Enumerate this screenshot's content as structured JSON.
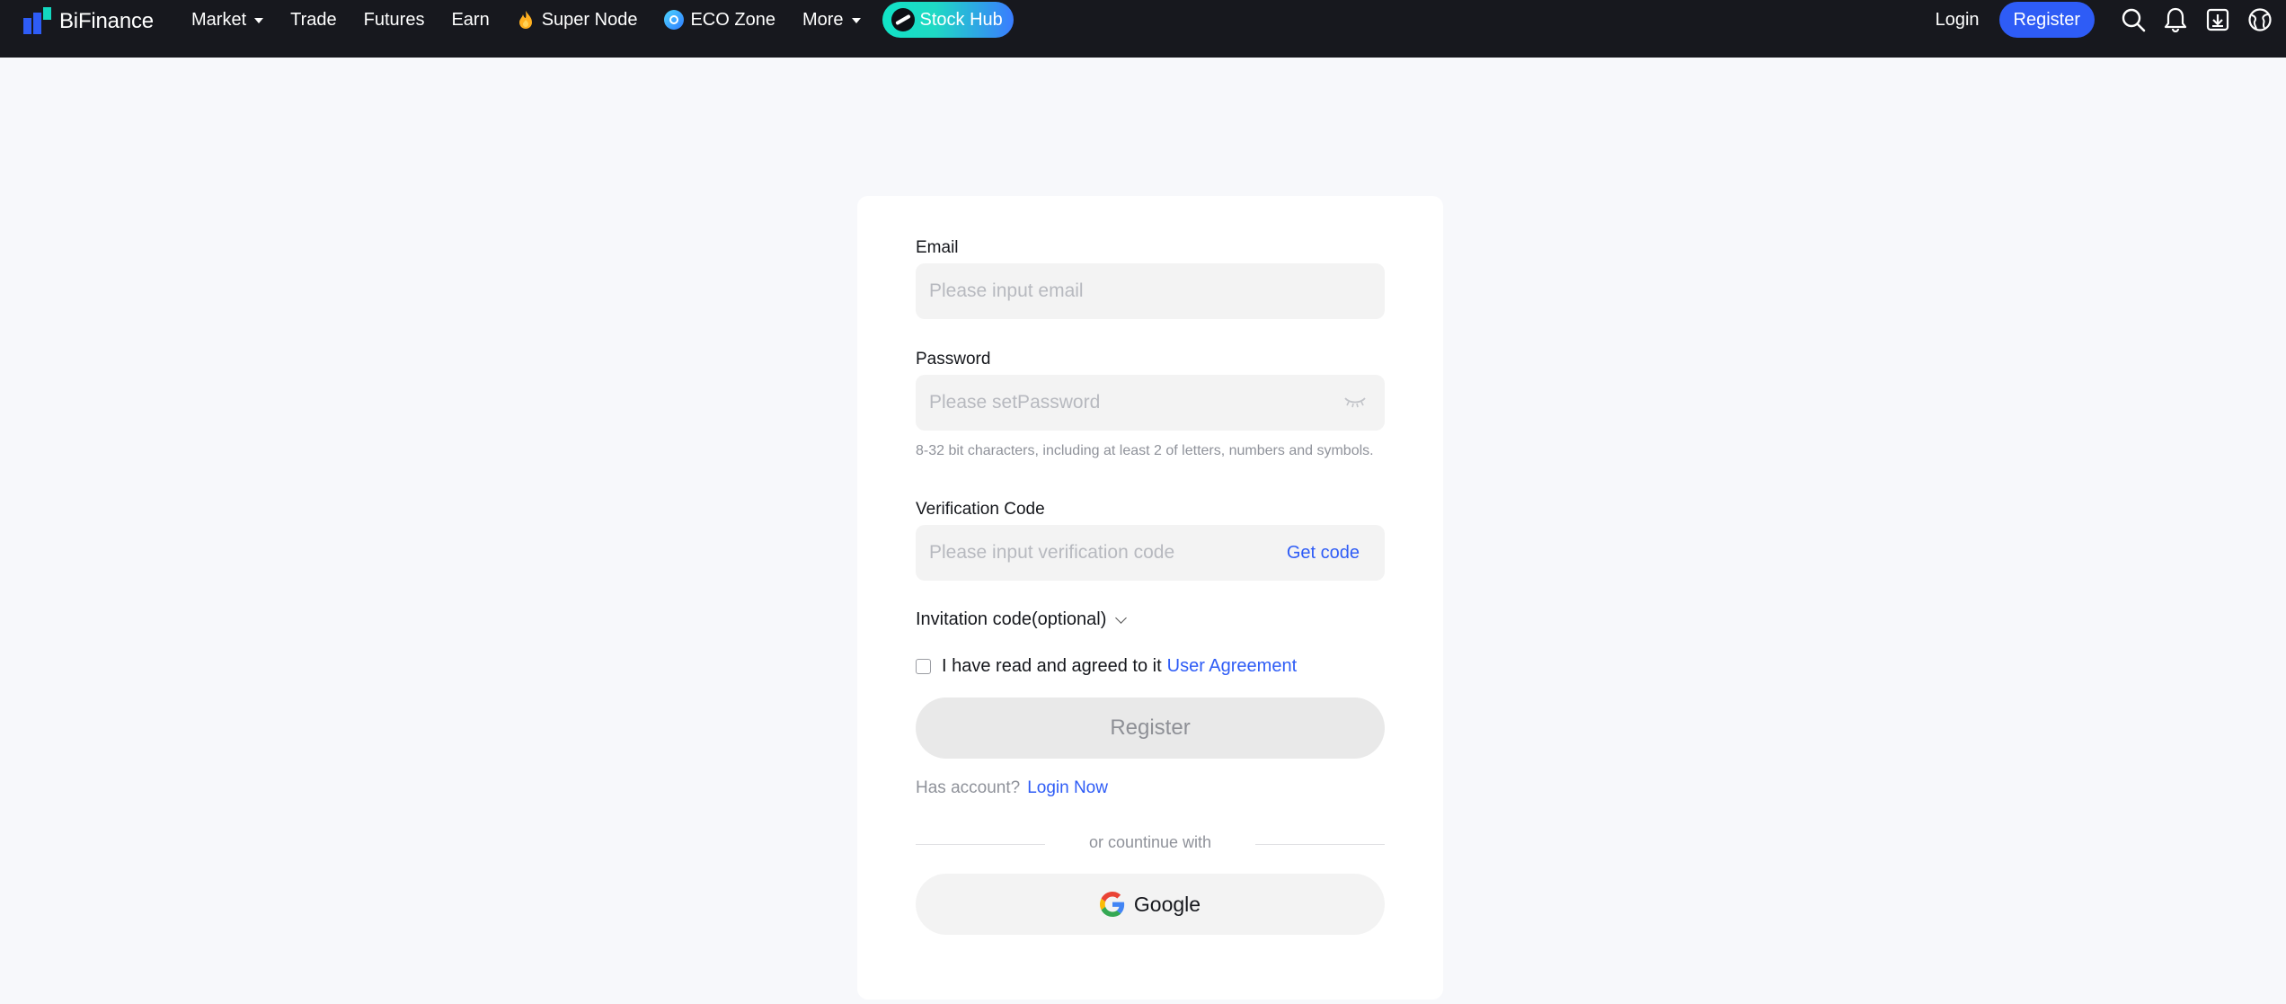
{
  "header": {
    "brand": "BiFinance",
    "nav": {
      "market": "Market",
      "trade": "Trade",
      "futures": "Futures",
      "earn": "Earn",
      "super_node": "Super Node",
      "eco_zone": "ECO Zone",
      "more": "More",
      "stock_hub": "Stock Hub"
    },
    "login": "Login",
    "register": "Register",
    "icons": [
      "search-icon",
      "bell-icon",
      "download-icon",
      "globe-icon"
    ]
  },
  "form": {
    "email": {
      "label": "Email",
      "placeholder": "Please input email",
      "value": ""
    },
    "password": {
      "label": "Password",
      "placeholder": "Please setPassword",
      "value": "",
      "hint": "8-32 bit characters, including at least 2 of letters, numbers and symbols."
    },
    "verification": {
      "label": "Verification Code",
      "placeholder": "Please input verification code",
      "value": "",
      "get_code": "Get code"
    },
    "invitation": "Invitation code(optional)",
    "agreement": {
      "text": "I have read and agreed to it",
      "link": "User Agreement",
      "checked": false
    },
    "submit": "Register",
    "has_account": {
      "text": "Has account?",
      "link": "Login Now"
    },
    "divider": "or countinue with",
    "google": "Google"
  },
  "colors": {
    "accent": "#2e5cf6",
    "topbar": "#17181e",
    "background": "#f7f8fb"
  }
}
